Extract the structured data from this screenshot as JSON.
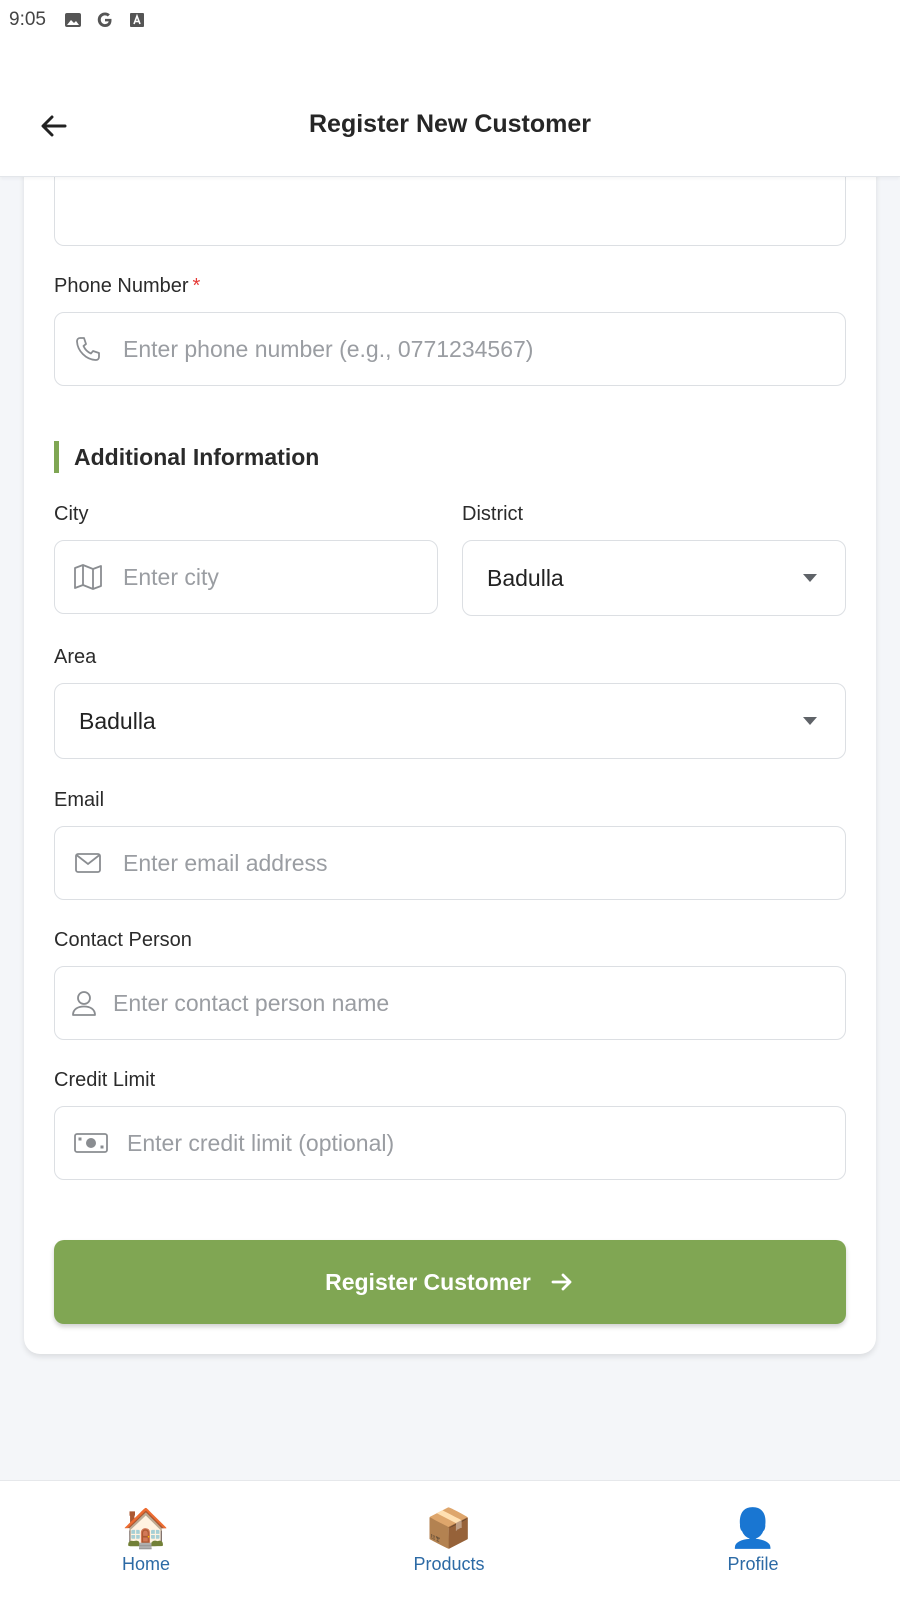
{
  "status_bar": {
    "time": "9:05"
  },
  "header": {
    "title": "Register New Customer"
  },
  "form": {
    "phone": {
      "label": "Phone Number",
      "required_mark": "*",
      "placeholder": "Enter phone number (e.g., 0771234567)"
    },
    "section_additional": "Additional Information",
    "city": {
      "label": "City",
      "placeholder": "Enter city"
    },
    "district": {
      "label": "District",
      "value": "Badulla"
    },
    "area": {
      "label": "Area",
      "value": "Badulla"
    },
    "email": {
      "label": "Email",
      "placeholder": "Enter email address"
    },
    "contact_person": {
      "label": "Contact Person",
      "placeholder": "Enter contact person name"
    },
    "credit_limit": {
      "label": "Credit Limit",
      "placeholder": "Enter credit limit (optional)"
    },
    "submit_label": "Register Customer"
  },
  "bottom_nav": [
    {
      "label": "Home",
      "icon": "🏠"
    },
    {
      "label": "Products",
      "icon": "📦"
    },
    {
      "label": "Profile",
      "icon": "👤"
    }
  ],
  "colors": {
    "accent": "#80a653",
    "nav_text": "#2c6aa5",
    "required": "#e53935"
  }
}
